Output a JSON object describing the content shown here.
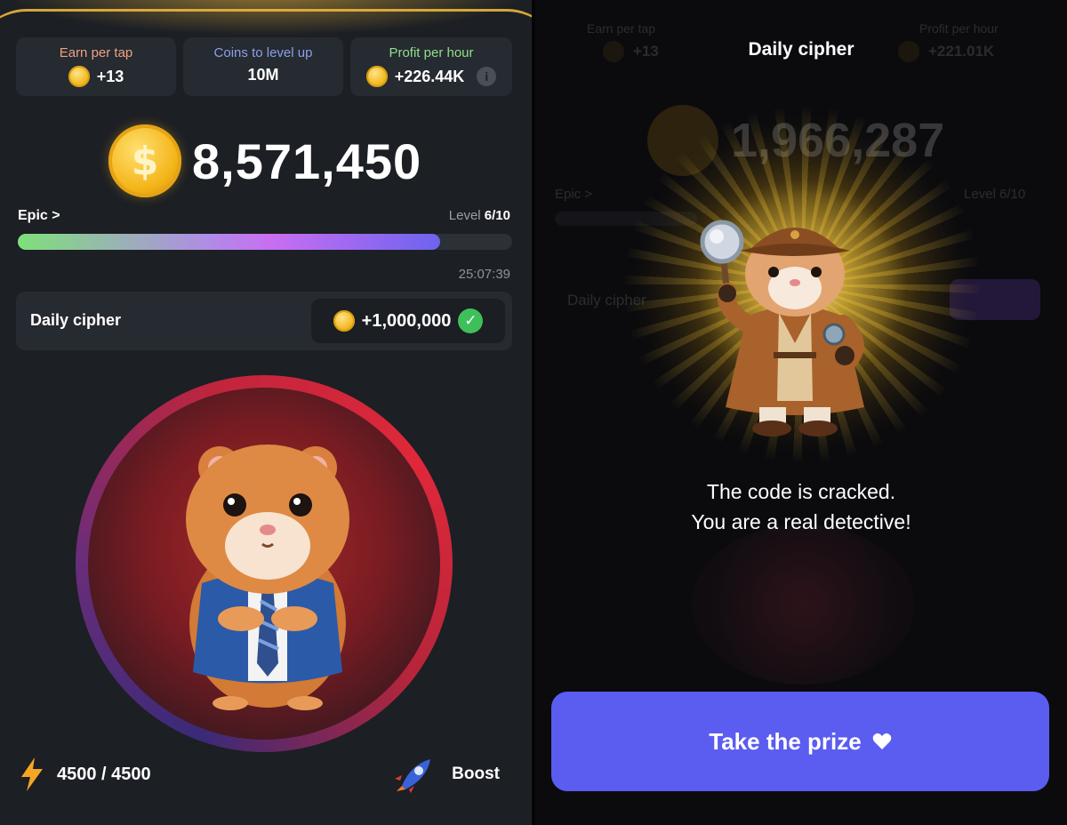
{
  "left": {
    "stats": [
      {
        "label": "Earn per tap",
        "value": "+13",
        "label_color": "#f0a080",
        "has_coin": true,
        "has_info": false
      },
      {
        "label": "Coins to level up",
        "value": "10M",
        "label_color": "#8aa0e8",
        "has_coin": false,
        "has_info": false
      },
      {
        "label": "Profit per hour",
        "value": "+226.44K",
        "label_color": "#8fe08a",
        "has_coin": true,
        "has_info": true
      }
    ],
    "info_symbol": "i",
    "balance": "8,571,450",
    "coin_symbol": "$",
    "league": "Epic >",
    "level_prefix": "Level",
    "level_value": "6/10",
    "level_progress_percent": 85.5,
    "timer": "25:07:39",
    "cipher": {
      "label": "Daily cipher",
      "reward": "+1,000,000",
      "check_symbol": "✓"
    },
    "energy": "4500 / 4500",
    "boost_label": "Boost"
  },
  "right": {
    "title": "Daily cipher",
    "ghost": {
      "earn_value": "+13",
      "profit_value": "+221.01K",
      "profit_label": "Profit per hour",
      "earn_label": "Earn per tap",
      "balance": "1,966,287",
      "league": "Epic >",
      "level": "Level 6/10",
      "cipher_label": "Daily cipher"
    },
    "message_line1": "The code is cracked.",
    "message_line2": "You are a real detective!",
    "prize_button": "Take the prize"
  },
  "colors": {
    "accent_purple": "#5b5cf0",
    "coin_gold": "#f2b81e",
    "check_green": "#3fbf5a",
    "panel_bg": "#1c1f24",
    "card_bg": "#262a31"
  },
  "icons": [
    "coin-icon",
    "info-icon",
    "check-icon",
    "lightning-icon",
    "rocket-icon",
    "heart-icon",
    "hamster-ceo-icon",
    "hamster-detective-icon",
    "magnifier-icon"
  ]
}
